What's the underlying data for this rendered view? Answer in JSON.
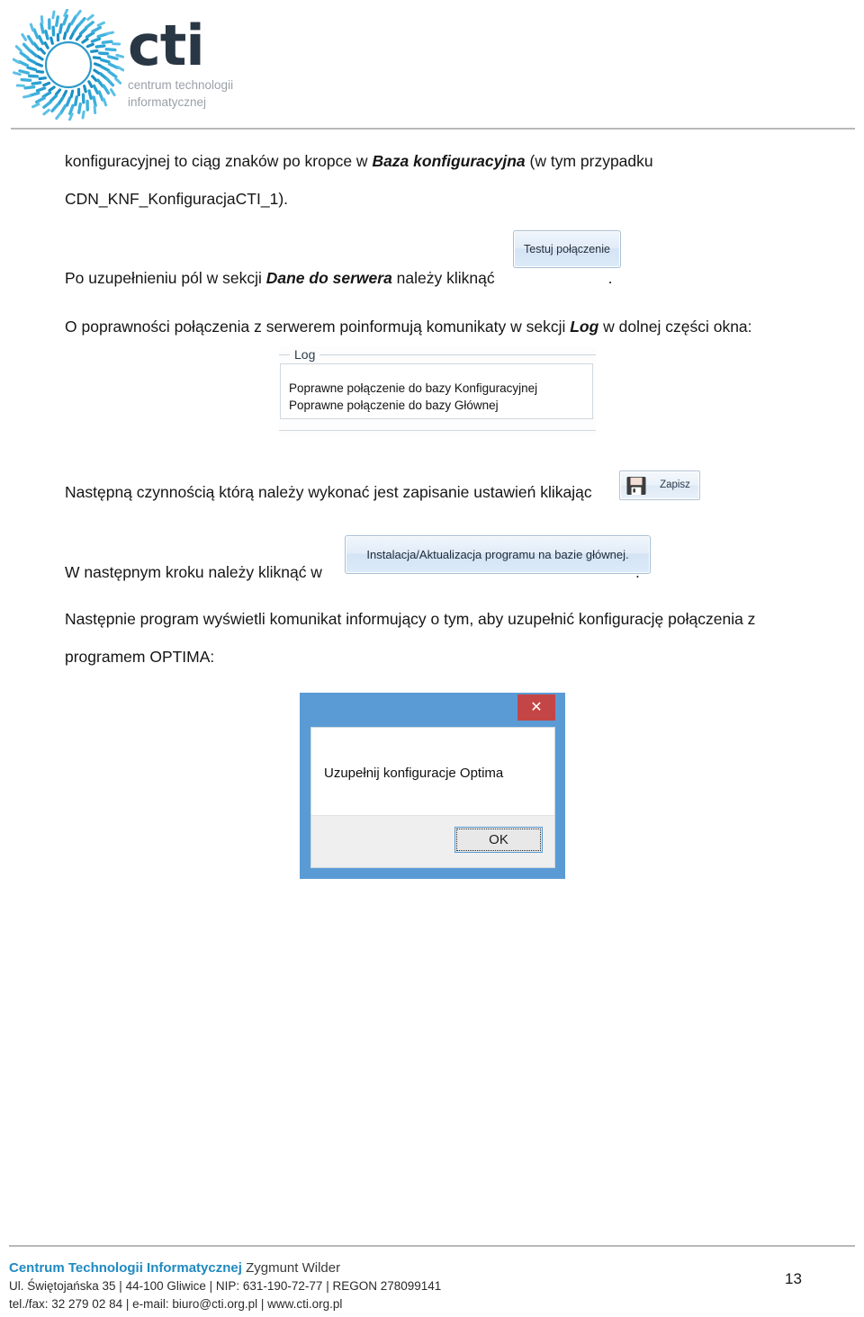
{
  "header": {
    "logo_word": "cti",
    "logo_tagline_line1": "centrum technologii",
    "logo_tagline_line2": "informatycznej",
    "logo_icon": "cti-swirl-logo",
    "brand_blue": "#2196c9",
    "brand_dark": "#293744"
  },
  "body": {
    "p1_part1": "konfiguracyjnej to ciąg znaków po kropce w ",
    "p1_bold": "Baza konfiguracyjna",
    "p1_part2": " (w tym przypadku",
    "p1_line2": "CDN_KNF_KonfiguracjaCTI_1).",
    "p2_part1": "Po uzupełnieniu pól w sekcji ",
    "p2_bold": "Dane do serwera",
    "p2_part2": " należy kliknąć",
    "p2_end": ".",
    "p3_part1": "O poprawności połączenia z serwerem poinformują komunikaty w sekcji ",
    "p3_bold": "Log",
    "p3_part2": " w dolnej części okna:",
    "p4_part1": "Następną czynnością którą należy wykonać jest zapisanie ustawień klikając",
    "p4_end": ".",
    "p5_part1": "W następnym kroku należy kliknąć w",
    "p5_end": ".",
    "p6_line1": "Następnie program wyświetli komunikat informujący o tym, aby uzupełnić konfigurację połączenia z",
    "p6_line2": "programem OPTIMA:"
  },
  "screenshots": {
    "test_button": {
      "label": "Testuj połączenie"
    },
    "log_groupbox": {
      "legend": "Log",
      "lines": [
        "Poprawne połączenie do bazy Konfiguracyjnej",
        "Poprawne połączenie do bazy Głównej"
      ]
    },
    "save_button": {
      "label": "Zapisz",
      "icon": "floppy-disk-icon"
    },
    "install_button": {
      "label": "Instalacja/Aktualizacja programu na bazie głównej."
    },
    "dialog": {
      "close_label": "✕",
      "close_icon": "close-icon",
      "message": "Uzupełnij konfiguracje Optima",
      "ok_label": "OK",
      "titlebar_color": "#5b9bd5",
      "close_color": "#c44545"
    }
  },
  "footer": {
    "company": "Centrum Technologii Informatycznej",
    "person": " Zygmunt Wilder",
    "address_line": "Ul. Świętojańska 35  |  44-100 Gliwice  |  NIP: 631-190-72-77  |  REGON 278099141",
    "contact_line": "tel./fax: 32 279 02 84  |  e-mail: biuro@cti.org.pl  |  www.cti.org.pl",
    "page_number": "13"
  }
}
